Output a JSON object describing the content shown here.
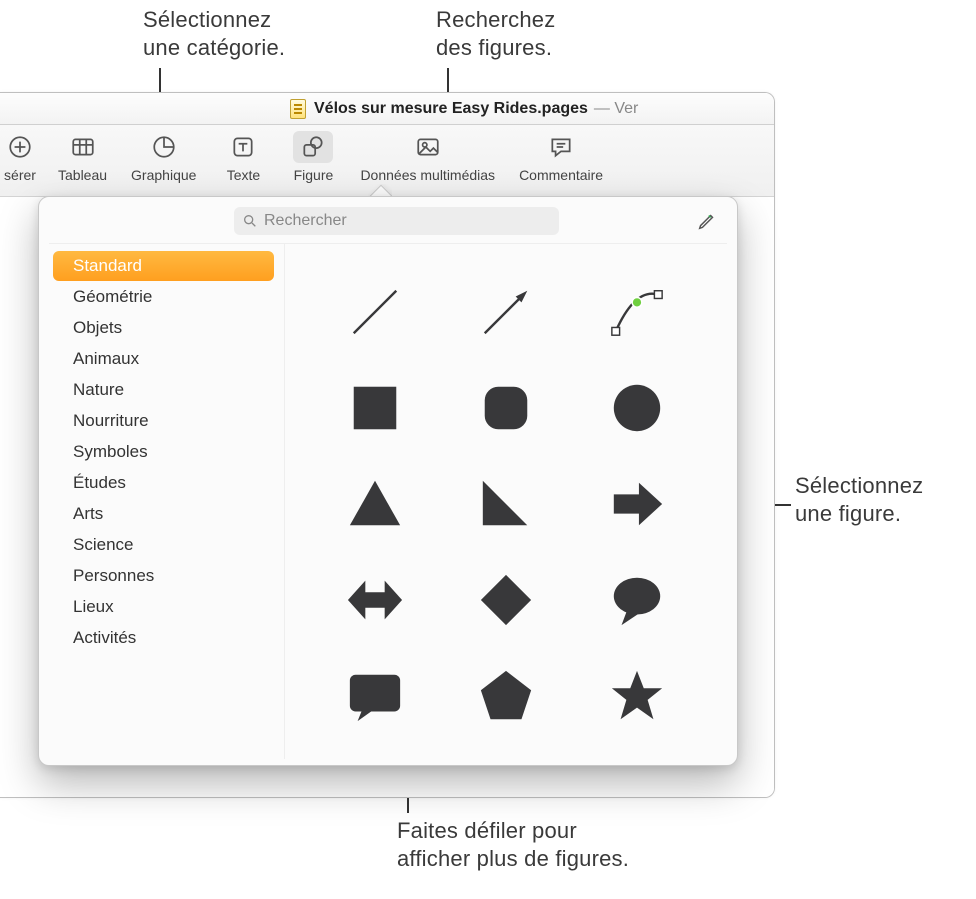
{
  "titlebar": {
    "filename": "Vélos sur mesure Easy Rides.pages",
    "suffix": "— Ver"
  },
  "toolbar": {
    "insert": "sérer",
    "table": "Tableau",
    "chart": "Graphique",
    "text": "Texte",
    "shape": "Figure",
    "media": "Données multimédias",
    "comment": "Commentaire"
  },
  "search": {
    "placeholder": "Rechercher"
  },
  "categories": [
    "Standard",
    "Géométrie",
    "Objets",
    "Animaux",
    "Nature",
    "Nourriture",
    "Symboles",
    "Études",
    "Arts",
    "Science",
    "Personnes",
    "Lieux",
    "Activités"
  ],
  "selected_category_index": 0,
  "callouts": {
    "select_category": "Sélectionnez\nune catégorie.",
    "search_shapes": "Recherchez\ndes figures.",
    "select_shape": "Sélectionnez\nune figure.",
    "scroll_more": "Faites défiler pour\nafficher plus de figures."
  }
}
